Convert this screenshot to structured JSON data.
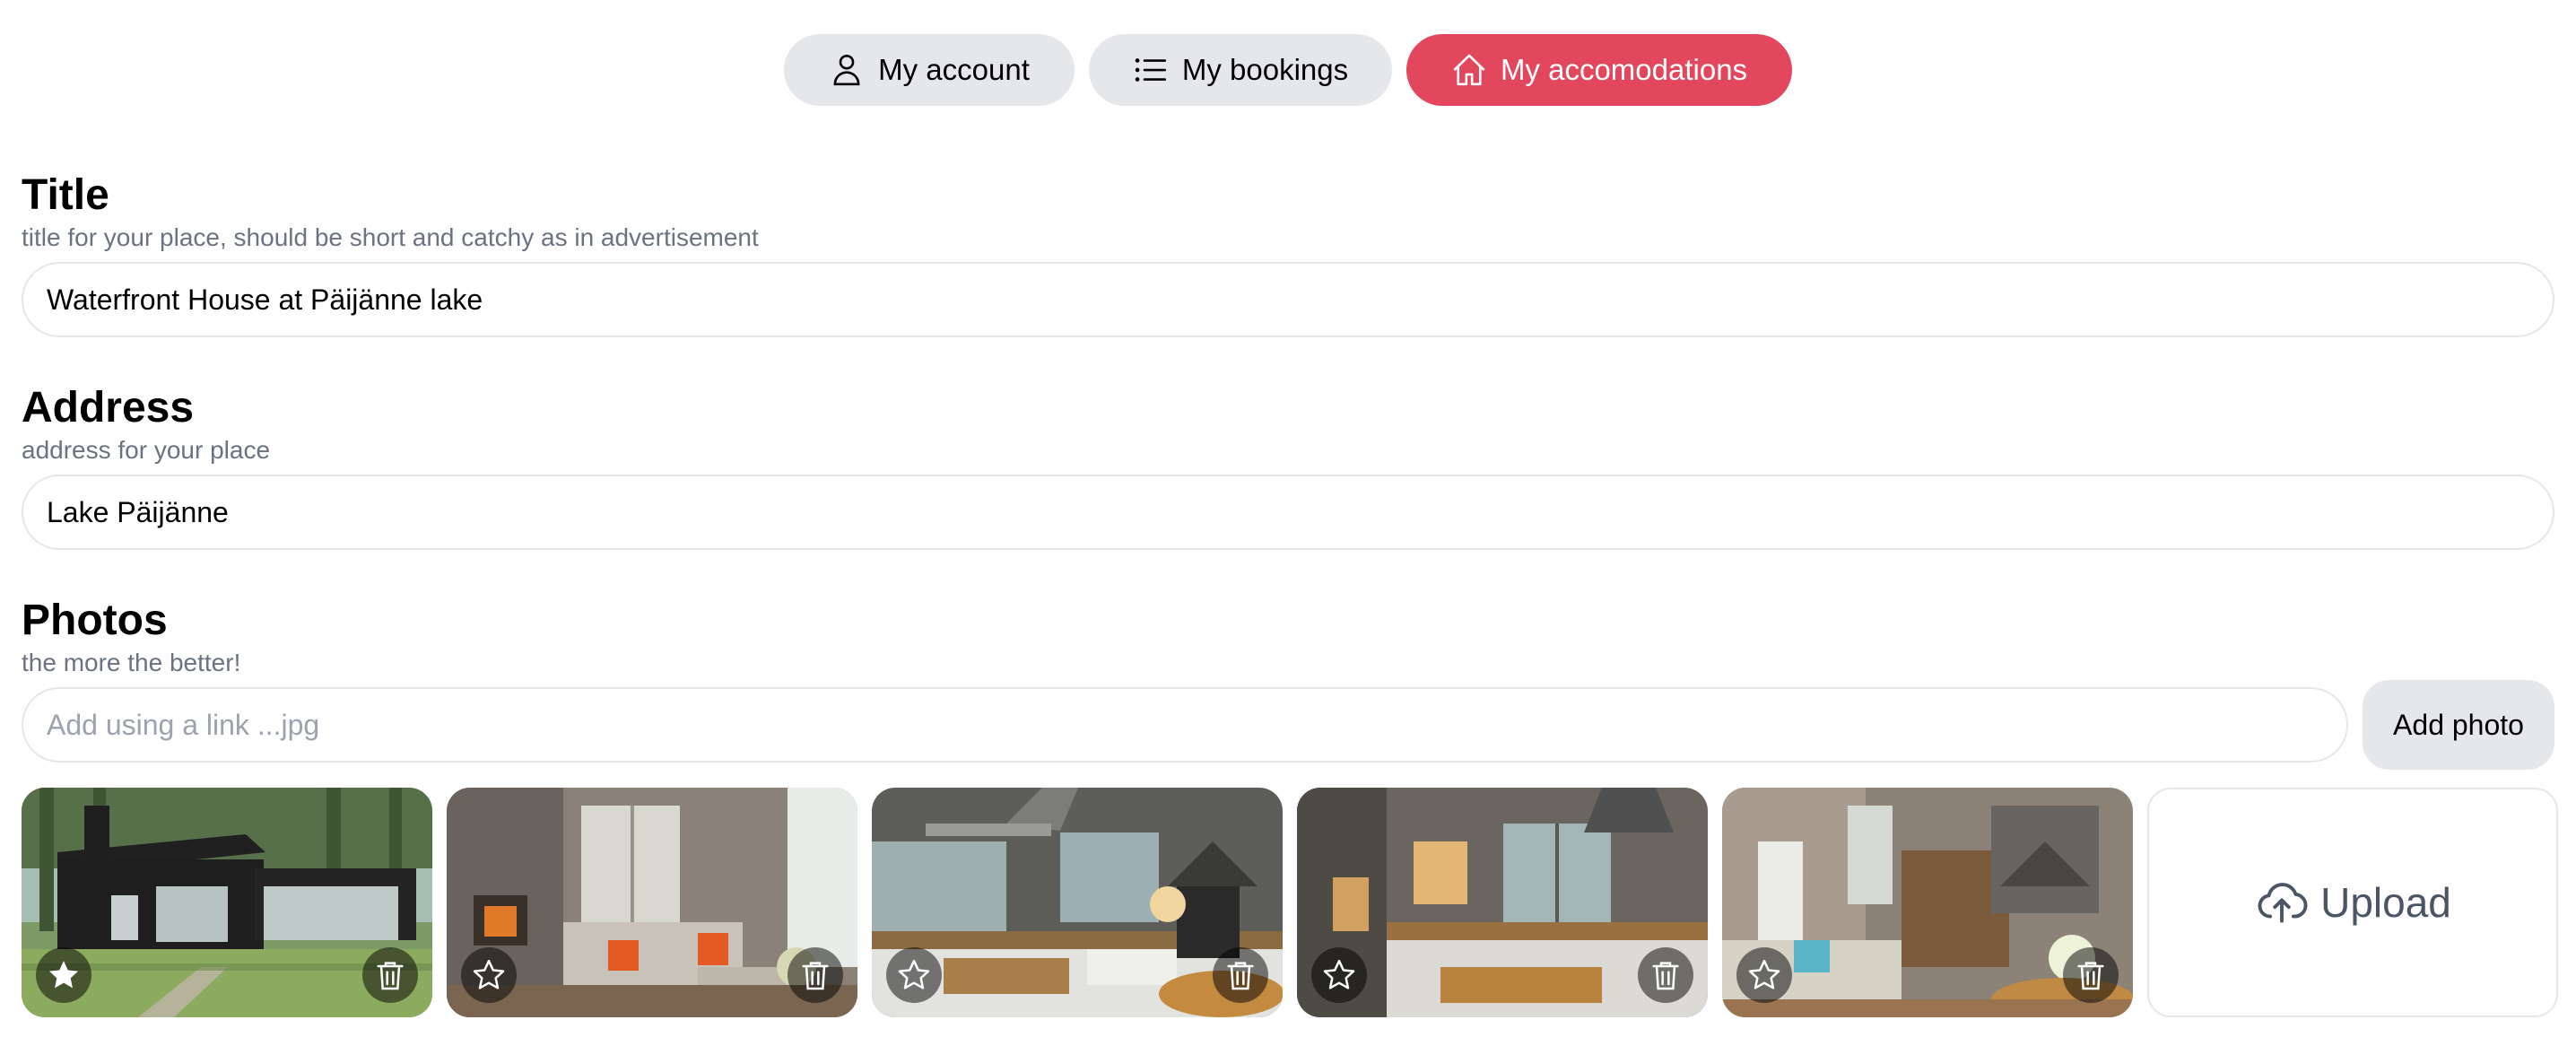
{
  "nav": {
    "account": "My account",
    "bookings": "My bookings",
    "accommodations": "My accomodations"
  },
  "title_field": {
    "heading": "Title",
    "hint": "title for your place, should be short and catchy as in advertisement",
    "value": "Waterfront House at Päijänne lake"
  },
  "address_field": {
    "heading": "Address",
    "hint": "address for your place",
    "value": "Lake Päijänne"
  },
  "photos_field": {
    "heading": "Photos",
    "hint": "the more the better!",
    "link_placeholder": "Add using a link ...jpg",
    "add_label": "Add photo",
    "upload_label": "Upload"
  },
  "colors": {
    "accent": "#e2475e",
    "pill": "#e5e7eb"
  }
}
